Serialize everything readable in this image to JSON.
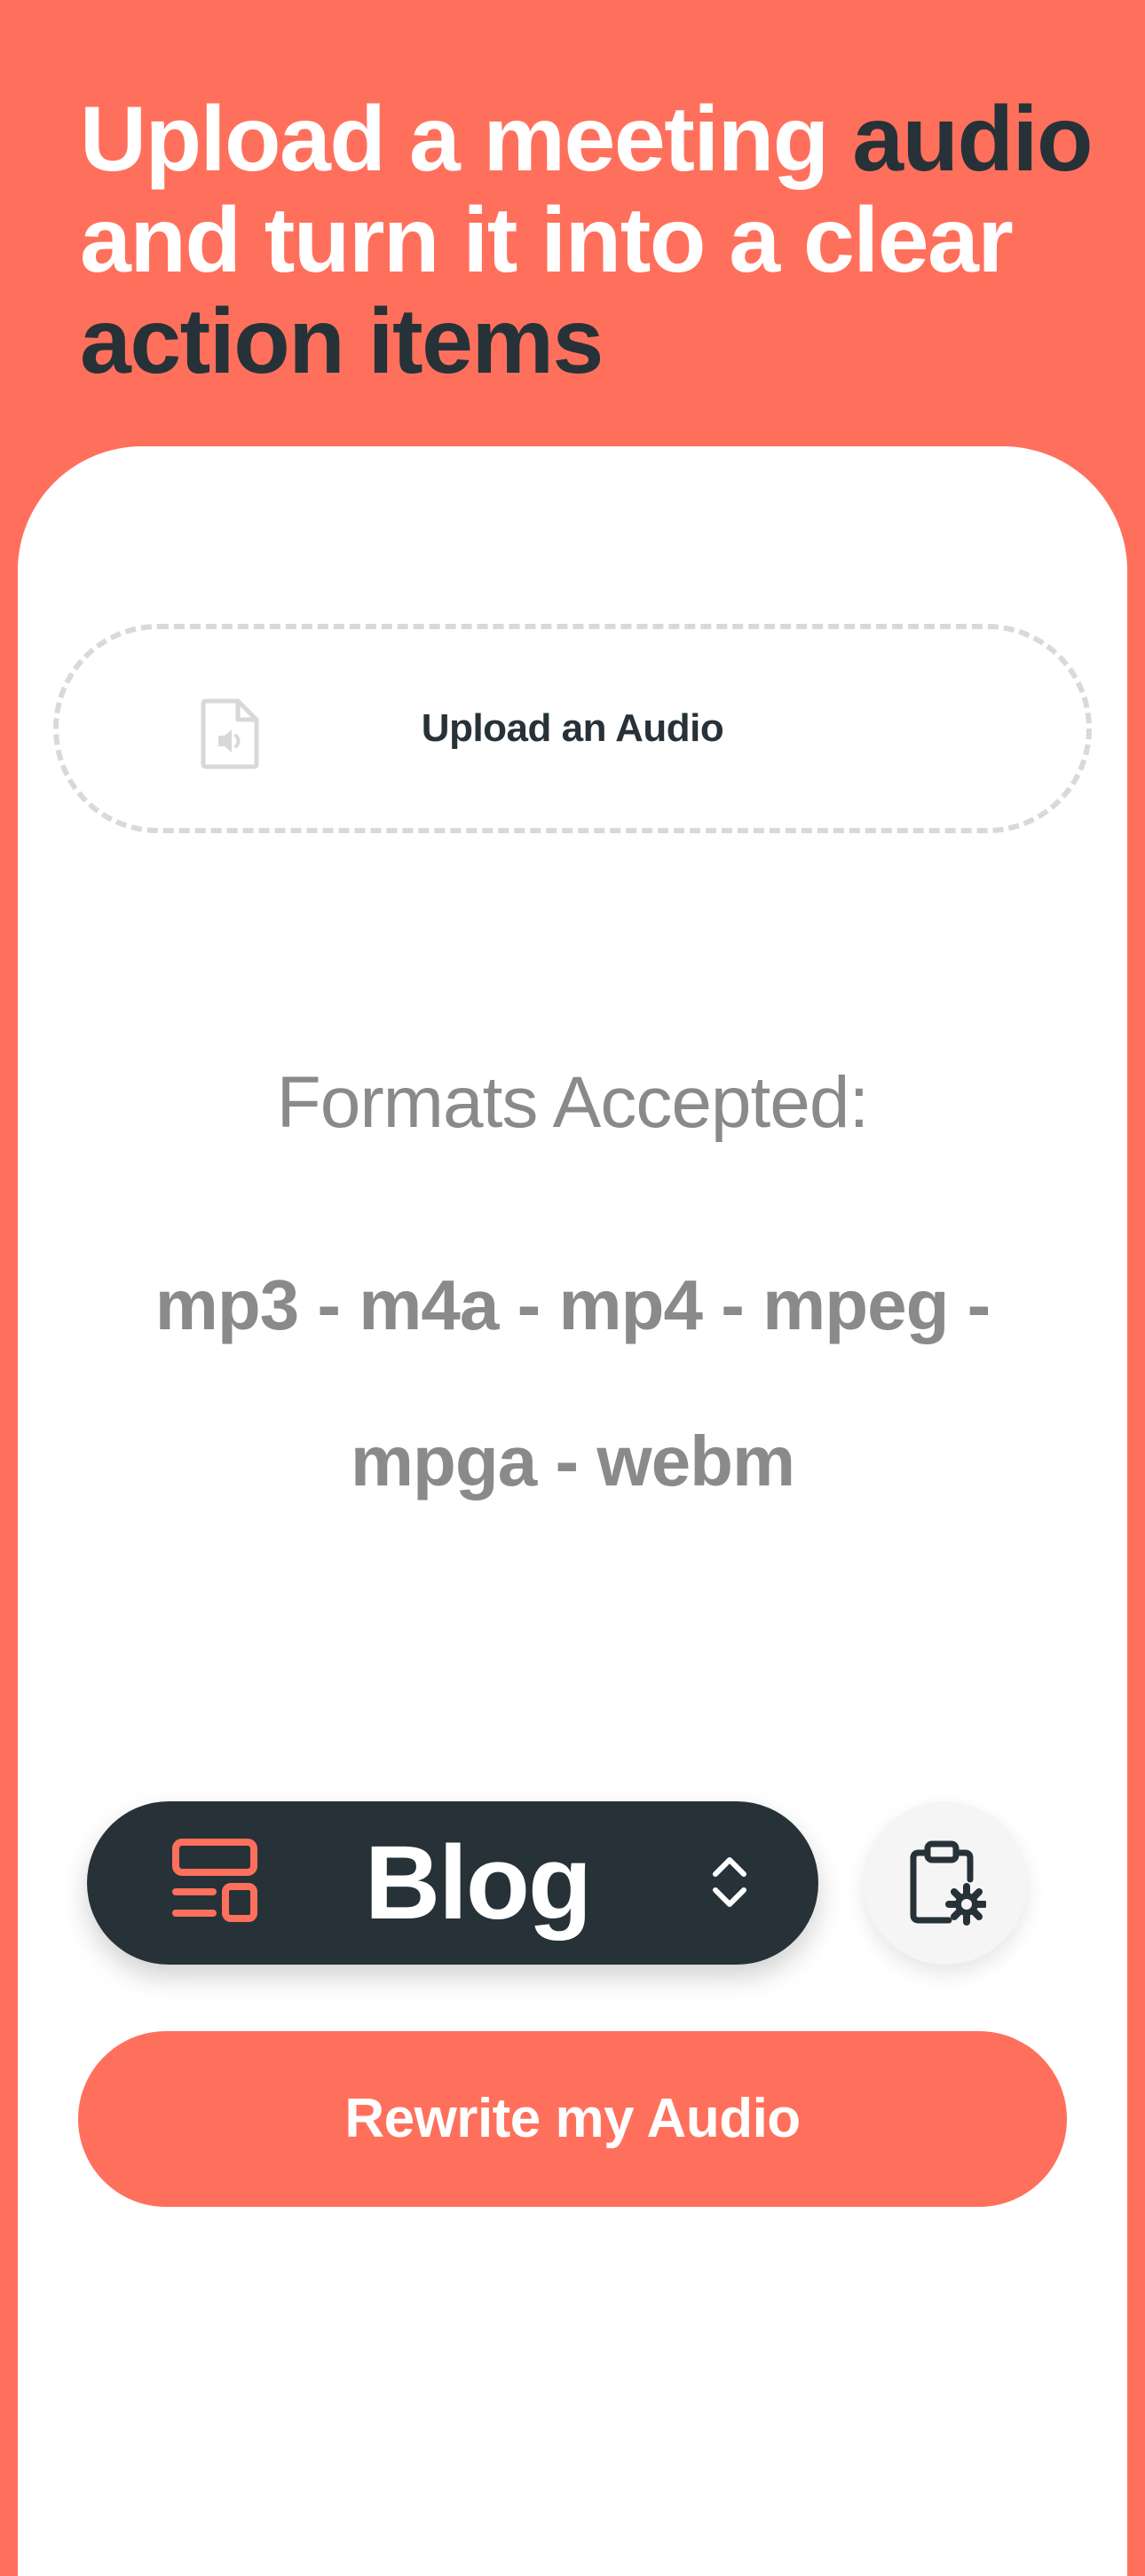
{
  "header": {
    "title_part1": "Upload a meeting ",
    "title_highlight1": "audio",
    "title_part2": " and turn it into a clear ",
    "title_highlight2": "action items"
  },
  "upload": {
    "label": "Upload an Audio",
    "icon": "audio-file-icon"
  },
  "formats": {
    "title": "Formats Accepted:",
    "list": "mp3 - m4a - mp4 - mpeg - mpga - webm"
  },
  "output_type": {
    "selected": "Blog",
    "icon": "layout-icon",
    "toggle_icon": "chevron-up-down-icon"
  },
  "settings": {
    "icon": "clipboard-gear-icon"
  },
  "actions": {
    "rewrite_label": "Rewrite my Audio"
  },
  "colors": {
    "brand": "#FF705C",
    "dark": "#263238",
    "muted": "#8A8A8A",
    "dashed_border": "#D9D9D9",
    "surface": "#FFFFFF"
  }
}
